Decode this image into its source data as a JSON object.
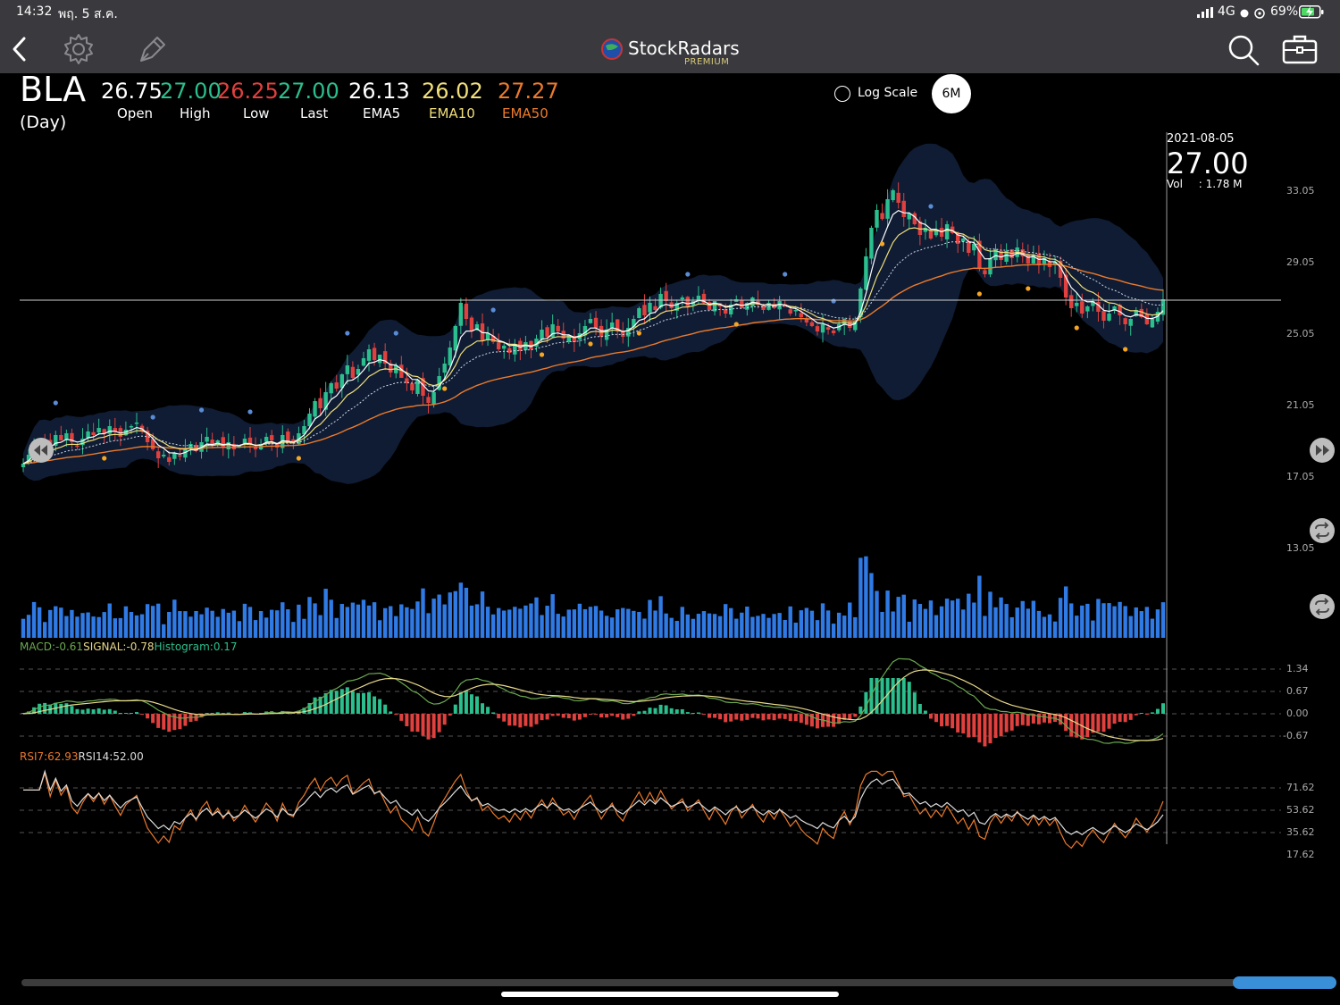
{
  "status_bar": {
    "time": "14:32",
    "date": "พฤ. 5 ส.ค.",
    "network": "4G",
    "battery": "69%"
  },
  "nav": {
    "brand": "StockRadars",
    "premium": "PREMIUM"
  },
  "quote": {
    "symbol": "BLA",
    "period": "(Day)",
    "open": "26.75",
    "high": "27.00",
    "low": "26.25",
    "last": "27.00",
    "ema5": "26.13",
    "ema10": "26.02",
    "ema50": "27.27",
    "labels": {
      "open": "Open",
      "high": "High",
      "low": "Low",
      "last": "Last",
      "ema5": "EMA5",
      "ema10": "EMA10",
      "ema50": "EMA50"
    }
  },
  "controls": {
    "log_scale": "Log Scale",
    "range": "6M"
  },
  "crosshair": {
    "date": "2021-08-05",
    "price": "27.00",
    "vol_label": "Vol",
    "vol_value": ": 1.78 M"
  },
  "price_axis": [
    "33.05",
    "29.05",
    "25.05",
    "21.05",
    "17.05",
    "13.05"
  ],
  "macd": {
    "macd_label": "MACD:",
    "macd_value": "-0.61",
    "signal_label": "SIGNAL:",
    "signal_value": "-0.78",
    "hist_label": "Histogram:",
    "hist_value": "0.17",
    "axis": [
      "1.34",
      "0.67",
      "0.00",
      "-0.67"
    ]
  },
  "rsi": {
    "rsi7_label": "RSI7:",
    "rsi7_value": "62.93",
    "rsi14_label": "RSI14:",
    "rsi14_value": "52.00",
    "axis": [
      "71.62",
      "53.62",
      "35.62",
      "17.62"
    ]
  },
  "colors": {
    "up": "#2bbf8e",
    "down": "#e0413e",
    "ema5": "#ffffff",
    "ema10": "#f2df7a",
    "ema50": "#ec7a2c",
    "volume": "#2f7ae5",
    "band": "#0f1c33",
    "macd_line": "#6aa84f",
    "signal_line": "#e8d98a",
    "rsi7": "#ec7a2c",
    "rsi14": "#dcdcdc"
  },
  "chart_data": {
    "type": "candlestick",
    "y_range": [
      13.05,
      35.0
    ],
    "close": [
      17.8,
      18.3,
      18.9,
      19.2,
      19.0,
      18.7,
      19.4,
      19.1,
      19.5,
      19.0,
      18.8,
      19.2,
      19.6,
      19.4,
      19.8,
      19.5,
      19.9,
      19.6,
      19.3,
      19.7,
      19.9,
      20.1,
      19.6,
      19.0,
      18.6,
      18.1,
      18.3,
      17.9,
      18.4,
      18.2,
      18.6,
      18.9,
      18.5,
      19.0,
      19.3,
      18.8,
      19.1,
      18.7,
      19.0,
      18.6,
      18.8,
      19.2,
      18.9,
      18.6,
      18.9,
      19.3,
      19.1,
      18.7,
      19.4,
      19.0,
      18.9,
      19.5,
      19.9,
      20.6,
      21.3,
      20.9,
      21.8,
      22.3,
      22.0,
      22.8,
      23.3,
      22.6,
      23.1,
      23.7,
      24.2,
      23.6,
      23.9,
      23.4,
      22.9,
      23.3,
      22.6,
      22.3,
      21.9,
      22.5,
      21.6,
      21.2,
      21.8,
      22.7,
      23.4,
      24.3,
      25.5,
      26.8,
      25.9,
      25.2,
      25.6,
      24.7,
      25.1,
      24.6,
      24.2,
      24.4,
      24.0,
      24.5,
      24.1,
      24.6,
      24.2,
      24.8,
      25.3,
      24.9,
      25.6,
      25.2,
      24.8,
      25.0,
      24.6,
      25.1,
      25.5,
      25.9,
      25.4,
      24.9,
      25.3,
      25.7,
      25.2,
      24.9,
      25.4,
      25.9,
      26.5,
      26.1,
      26.8,
      26.4,
      27.3,
      26.9,
      26.5,
      26.8,
      27.1,
      26.6,
      26.9,
      27.2,
      26.8,
      26.4,
      26.9,
      26.6,
      26.2,
      26.7,
      27.0,
      26.5,
      26.8,
      27.1,
      26.7,
      26.4,
      26.8,
      26.5,
      26.9,
      26.6,
      26.2,
      26.4,
      26.0,
      25.7,
      25.5,
      25.2,
      25.6,
      25.3,
      25.1,
      25.6,
      25.9,
      25.4,
      25.8,
      27.6,
      29.4,
      31.0,
      32.0,
      31.5,
      32.6,
      33.1,
      32.4,
      31.6,
      31.8,
      31.2,
      30.6,
      31.0,
      30.4,
      30.9,
      30.5,
      31.2,
      30.7,
      30.1,
      30.4,
      29.6,
      30.1,
      28.7,
      28.4,
      29.3,
      29.8,
      29.2,
      29.7,
      29.3,
      29.9,
      29.4,
      29.0,
      29.5,
      28.9,
      29.3,
      28.8,
      29.1,
      28.2,
      27.1,
      26.5,
      26.8,
      26.2,
      26.6,
      26.9,
      26.3,
      25.8,
      26.2,
      26.6,
      26.1,
      25.6,
      25.9,
      26.4,
      26.0,
      25.6,
      25.9,
      26.3,
      27.0
    ]
  }
}
